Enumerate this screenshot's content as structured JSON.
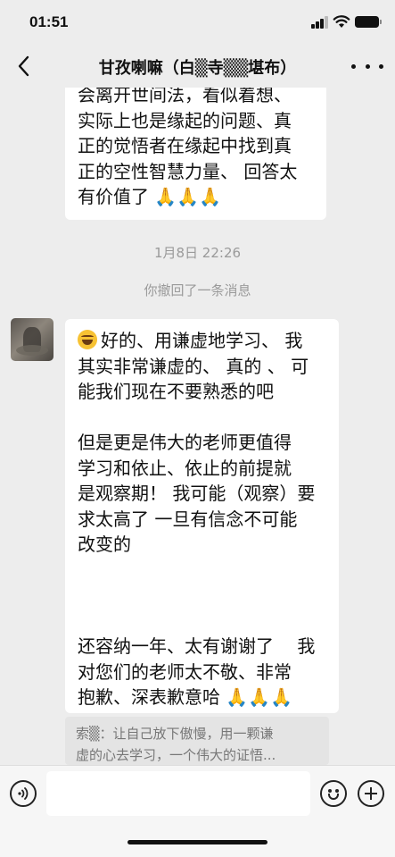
{
  "status_bar": {
    "time": "01:51"
  },
  "nav": {
    "title": "甘孜喇嘛（白▒寺▒▒堪布）",
    "back_icon": "chevron-left-icon",
    "more_icon": "more-dots-icon"
  },
  "messages": {
    "top_bubble_lines": [
      "会离开世间法，看似着想、",
      "实际上也是缘起的问题、真",
      "正的觉悟者在缘起中找到真",
      "正的空性智慧力量、 回答太",
      "有价值了 🙏🙏🙏"
    ],
    "timestamp": "1月8日 22:26",
    "recalled_notice": "你撤回了一条消息",
    "main_bubble": {
      "emoji_icon": "laughing-tears-emoji-icon",
      "lines": [
        "好的、用谦虚地学习、 我",
        "其实非常谦虚的、 真的 、 可",
        "能我们现在不要熟悉的吧",
        "",
        "但是更是伟大的老师更值得",
        "学习和依止、依止的前提就",
        "是观察期！ 我可能（观察）要",
        "求太高了 一旦有信念不可能",
        "改变的",
        "",
        "",
        "",
        "还容纳一年、太有谢谢了 　我",
        "对您们的老师太不敬、非常",
        "抱歉、深表歉意哈 🙏🙏🙏"
      ]
    },
    "quote_lines": [
      "索▒：让自己放下傲慢，用一颗谦",
      "虚的心去学习，一个伟大的证悟..."
    ]
  },
  "input_bar": {
    "voice_icon": "voice-icon",
    "input_value": "",
    "emoji_icon": "smiley-icon",
    "plus_icon": "plus-circle-icon"
  },
  "colors": {
    "background": "#ededed",
    "bubble": "#ffffff",
    "system_text": "#9a9a9a"
  }
}
